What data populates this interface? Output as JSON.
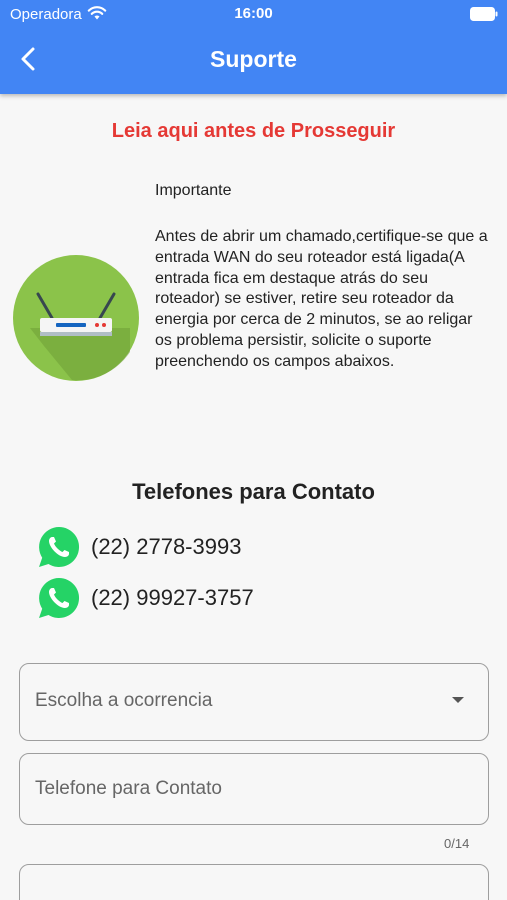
{
  "status_bar": {
    "carrier": "Operadora",
    "time": "16:00"
  },
  "appbar": {
    "title": "Suporte",
    "back_icon": "chevron-left-icon"
  },
  "warning": {
    "title": "Leia aqui antes de Prosseguir"
  },
  "info": {
    "label": "Importante",
    "text": "Antes de abrir um chamado,certifique-se que a entrada WAN do seu roteador está ligada(A entrada fica em destaque atrás do seu roteador) se estiver, retire seu roteador da energia por cerca de 2 minutos, se ao religar os problema persistir, solicite o suporte preenchendo os campos abaixos."
  },
  "contacts": {
    "title": "Telefones para Contato",
    "phones": [
      "(22) 2778-3993",
      "(22) 99927-3757"
    ]
  },
  "form": {
    "occurrence_placeholder": "Escolha a ocorrencia",
    "phone_placeholder": "Telefone para Contato",
    "phone_counter": "0/14"
  },
  "colors": {
    "primary": "#4285f4",
    "warning": "#e53935",
    "whatsapp": "#25d366",
    "avatar": "#8bc34a"
  }
}
